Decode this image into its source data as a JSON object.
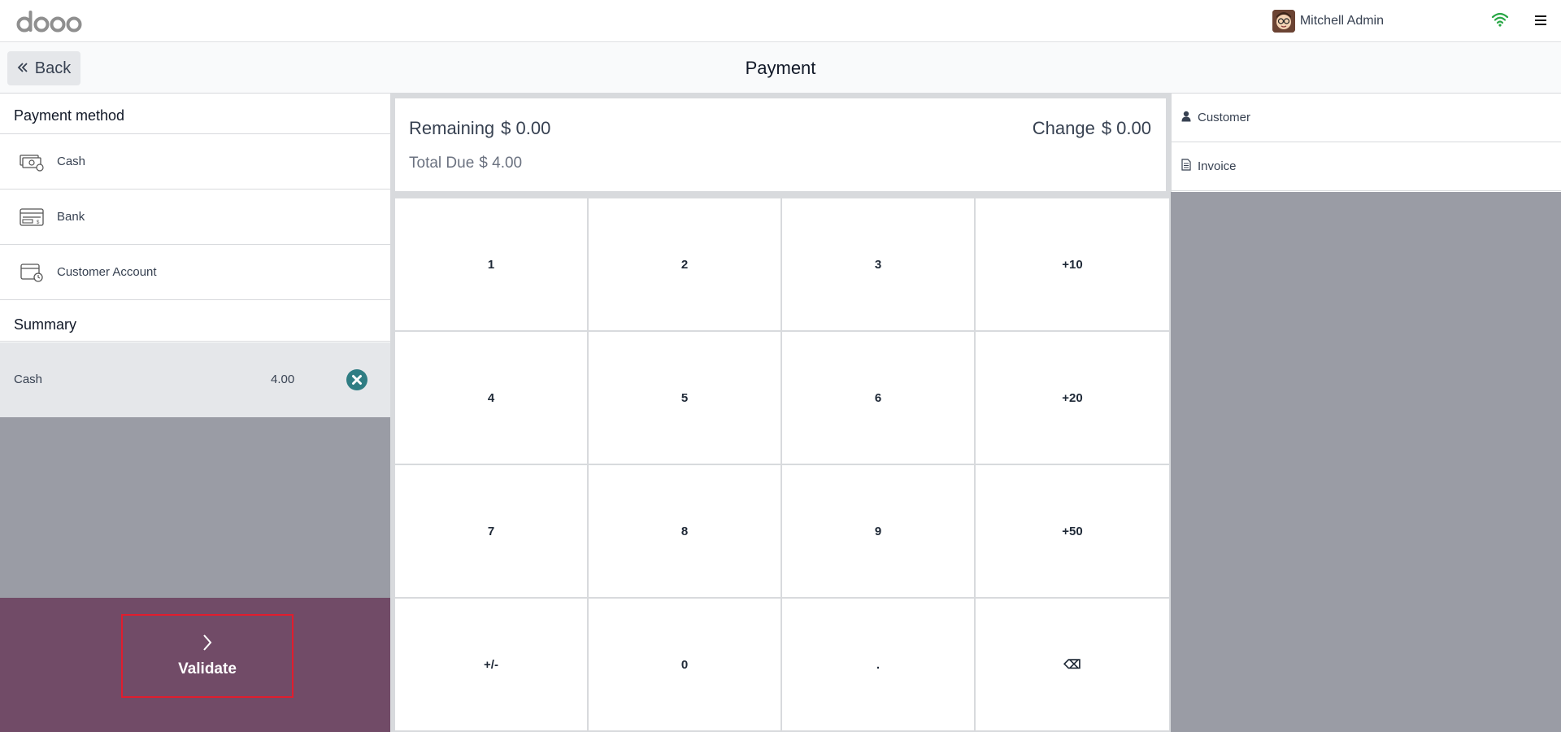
{
  "app": {
    "logo_text": "odoo"
  },
  "user": {
    "name": "Mitchell Admin"
  },
  "header": {
    "back_label": "Back",
    "title": "Payment"
  },
  "payment_methods": {
    "title": "Payment method",
    "items": [
      {
        "label": "Cash",
        "icon": "cash-icon"
      },
      {
        "label": "Bank",
        "icon": "bank-card-icon"
      },
      {
        "label": "Customer Account",
        "icon": "customer-account-icon"
      }
    ]
  },
  "summary": {
    "title": "Summary",
    "lines": [
      {
        "method": "Cash",
        "amount": "4.00"
      }
    ]
  },
  "totals": {
    "remaining_label": "Remaining",
    "remaining_value": "$ 0.00",
    "change_label": "Change",
    "change_value": "$ 0.00",
    "due_label": "Total Due",
    "due_value": "$ 4.00"
  },
  "numpad": {
    "keys": [
      "1",
      "2",
      "3",
      "+10",
      "4",
      "5",
      "6",
      "+20",
      "7",
      "8",
      "9",
      "+50",
      "+/-",
      "0",
      ".",
      "⌫"
    ]
  },
  "validate": {
    "label": "Validate"
  },
  "side": {
    "customer_label": "Customer",
    "invoice_label": "Invoice"
  },
  "colors": {
    "brand": "#714b67",
    "remove": "#2f7d83",
    "wifi": "#28a745"
  }
}
